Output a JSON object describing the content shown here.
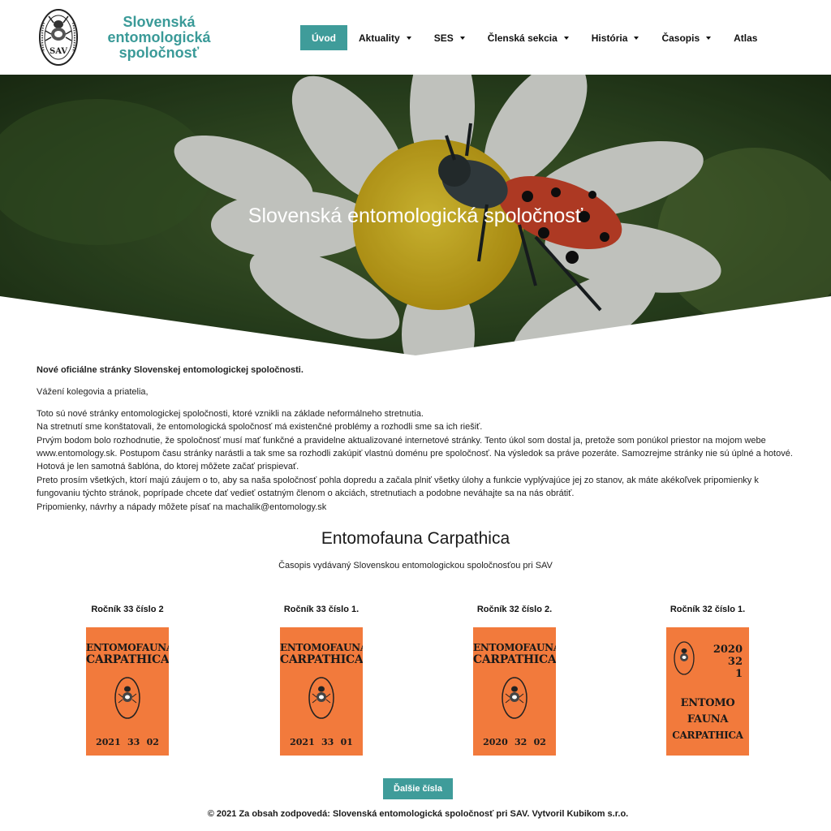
{
  "site": {
    "title_line1": "Slovenská",
    "title_line2": "entomologická",
    "title_line3": "spoločnosť",
    "logo_text": "SAV"
  },
  "nav": {
    "items": [
      {
        "label": "Úvod",
        "active": true,
        "dropdown": false
      },
      {
        "label": "Aktuality",
        "active": false,
        "dropdown": true
      },
      {
        "label": "SES",
        "active": false,
        "dropdown": true
      },
      {
        "label": "Členská sekcia",
        "active": false,
        "dropdown": true
      },
      {
        "label": "História",
        "active": false,
        "dropdown": true
      },
      {
        "label": "Časopis",
        "active": false,
        "dropdown": true
      },
      {
        "label": "Atlas",
        "active": false,
        "dropdown": false
      }
    ]
  },
  "hero": {
    "title": "Slovenská entomologická spoločnosť"
  },
  "content": {
    "heading": "Nové oficiálne stránky Slovenskej entomologickej spoločnosti.",
    "greeting": "Vážení kolegovia a priatelia,",
    "lines": [
      "Toto sú nové stránky entomologickej spoločnosti, ktoré vznikli na základe neformálneho stretnutia.",
      "Na stretnutí sme konštatovali, že entomologická spoločnosť má existenčné problémy a rozhodli sme sa ich riešiť.",
      "Prvým bodom bolo rozhodnutie, že spoločnosť musí mať funkčné a pravidelne aktualizované internetové stránky. Tento úkol som dostal ja, pretože som ponúkol priestor na mojom webe",
      "www.entomology.sk. Postupom času stránky narástli a tak sme sa rozhodli zakúpiť vlastnú doménu pre spoločnosť.  Na výsledok sa práve pozeráte. Samozrejme stránky nie sú úplné a hotové.",
      "Hotová je len samotná šablóna, do ktorej môžete začať prispievať.",
      "Preto prosím všetkých, ktorí majú záujem o to, aby sa naša spoločnosť pohla dopredu a začala plniť všetky úlohy a funkcie vyplývajúce jej zo stanov, ak máte akékoľvek pripomienky k",
      "fungovaniu týchto stránok, poprípade chcete dať vedieť ostatným členom o akciách, stretnutiach a podobne neváhajte sa na nás obrátiť.",
      "Pripomienky, návrhy a nápady môžete písať na machalik@entomology.sk"
    ]
  },
  "journal": {
    "title": "Entomofauna Carpathica",
    "subtitle": "Časopis vydávaný Slovenskou entomologickou spoločnosťou pri SAV",
    "issues": [
      {
        "label": "Ročník 33 číslo 2",
        "cover_line1": "ENTOMOFAUNA",
        "cover_line2": "CARPATHICA",
        "year": "2021",
        "volume": "33",
        "number": "02"
      },
      {
        "label": "Ročník 33 číslo 1.",
        "cover_line1": "ENTOMOFAUNA",
        "cover_line2": "CARPATHICA",
        "year": "2021",
        "volume": "33",
        "number": "01"
      },
      {
        "label": "Ročník 32 číslo 2.",
        "cover_line1": "ENTOMOFAUNA",
        "cover_line2": "CARPATHICA",
        "year": "2020",
        "volume": "32",
        "number": "02"
      },
      {
        "label": "Ročník 32 číslo 1.",
        "cover_line1": "ENTOMO",
        "cover_line2": "FAUNA",
        "cover_line3": "CARPATHICA",
        "year": "2020",
        "volume": "32",
        "number": "1"
      }
    ],
    "more_button": "Ďalšie čísla"
  },
  "footer": {
    "text": "© 2021 Za obsah zodpovedá: Slovenská entomologická spoločnosť pri SAV. Vytvoril Kubikom s.r.o."
  },
  "colors": {
    "accent": "#3f9c9a",
    "title_teal": "#3a9a98",
    "cover_orange": "#f27a3c"
  }
}
